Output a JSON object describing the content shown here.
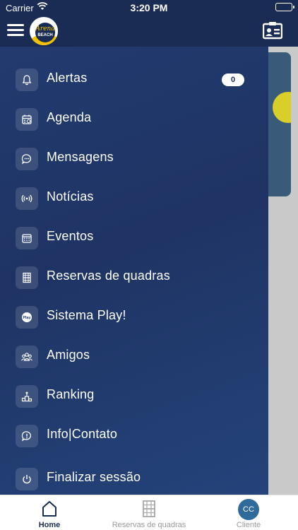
{
  "status_bar": {
    "carrier": "Carrier",
    "time": "3:20 PM"
  },
  "header": {
    "logo_text": "Arena BEACH",
    "menu_icon": "hamburger-icon",
    "contact_icon": "contact-card-icon"
  },
  "drawer": {
    "items": [
      {
        "label": "Alertas",
        "icon": "bell-icon",
        "badge": "0"
      },
      {
        "label": "Agenda",
        "icon": "calendar-icon"
      },
      {
        "label": "Mensagens",
        "icon": "chat-bubble-icon"
      },
      {
        "label": "Notícias",
        "icon": "broadcast-icon"
      },
      {
        "label": "Eventos",
        "icon": "calendar-grid-icon"
      },
      {
        "label": "Reservas de quadras",
        "icon": "court-icon"
      },
      {
        "label": "Sistema Play!",
        "icon": "play-badge-icon"
      },
      {
        "label": "Amigos",
        "icon": "friends-icon"
      },
      {
        "label": "Ranking",
        "icon": "podium-icon"
      },
      {
        "label": "Info|Contato",
        "icon": "info-bubble-icon"
      },
      {
        "label": "Finalizar sessão",
        "icon": "power-icon"
      }
    ]
  },
  "tabbar": {
    "tabs": [
      {
        "label": "Home",
        "icon": "home-icon",
        "active": true
      },
      {
        "label": "Reservas de quadras",
        "icon": "court-icon",
        "active": false
      },
      {
        "label": "Cliente",
        "avatar_initials": "CC",
        "active": false
      }
    ]
  },
  "colors": {
    "primary": "#1b2c54",
    "drawer": "#223a6f",
    "accent_yellow": "#f2c200",
    "avatar": "#2f6b9a"
  }
}
